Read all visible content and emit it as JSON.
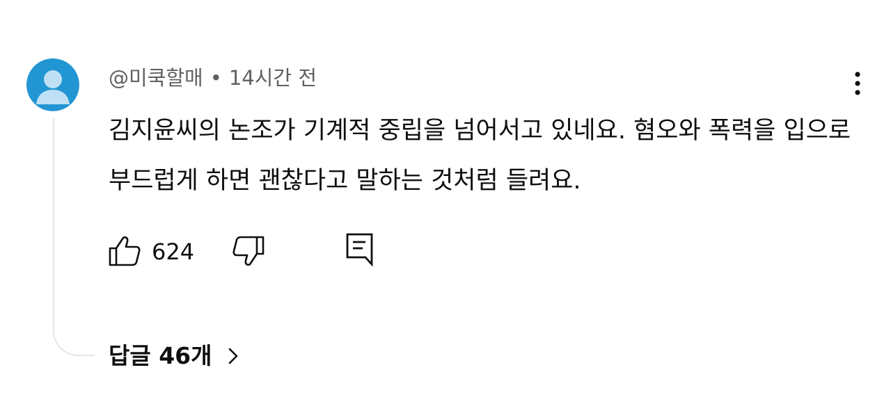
{
  "comment": {
    "author": "@미쿡할매",
    "separator": "•",
    "time": "14시간 전",
    "text": "김지윤씨의 논조가 기계적 중립을 넘어서고 있네요. 혐오와 폭력을 입으로 부드럽게 하면 괜찮다고 말하는 것처럼 들려요.",
    "like_count": "624",
    "replies_label": "답글 46개"
  },
  "icons": {
    "avatar": "default-user-avatar-icon",
    "more": "more-vertical-icon",
    "like": "thumbs-up-icon",
    "dislike": "thumbs-down-icon",
    "reply": "reply-comment-icon",
    "replies_chevron": "chevron-right-icon"
  },
  "colors": {
    "avatar_background": "#2196d3",
    "avatar_figure": "#bfe0f5",
    "secondary_text": "#606060",
    "primary_text": "#0f0f0f",
    "thread_line": "#e5e5e5"
  }
}
